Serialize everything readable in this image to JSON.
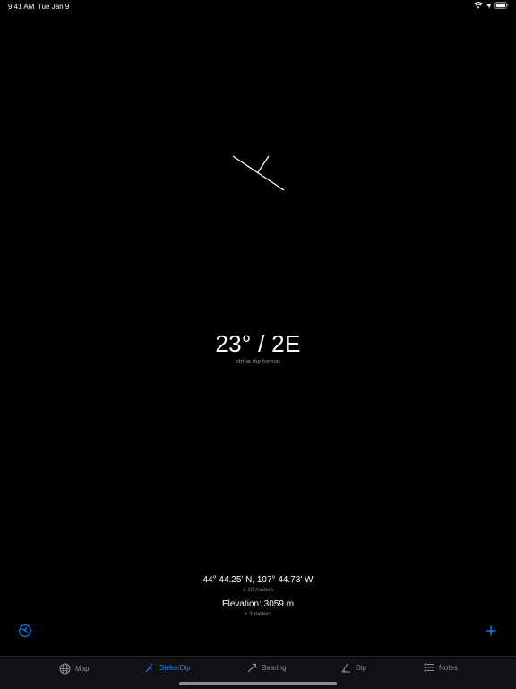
{
  "status_bar": {
    "time": "9:41 AM",
    "date": "Tue Jan 9"
  },
  "reading": {
    "value": "23° / 2E",
    "format_label": "strike dip format"
  },
  "location": {
    "coordinates": "44° 44.25' N, 107° 44.73' W",
    "coordinates_accuracy": "± 10 meters",
    "elevation": "Elevation: 3059 m",
    "elevation_accuracy": "± 3 meters"
  },
  "tabs": [
    {
      "label": "Map",
      "icon": "globe-icon",
      "active": false
    },
    {
      "label": "Strike/Dip",
      "icon": "strike-dip-icon",
      "active": true
    },
    {
      "label": "Bearing",
      "icon": "bearing-arrow-icon",
      "active": false
    },
    {
      "label": "Dip",
      "icon": "dip-icon",
      "active": false
    },
    {
      "label": "Notes",
      "icon": "list-icon",
      "active": false
    }
  ],
  "colors": {
    "accent": "#0a84ff",
    "background": "#000000",
    "inactive": "#8e8e93"
  }
}
